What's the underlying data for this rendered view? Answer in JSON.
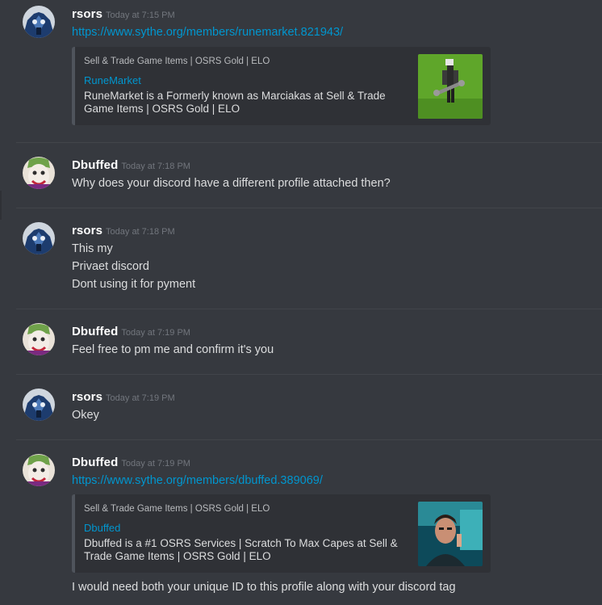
{
  "messages": [
    {
      "author": "rsors",
      "timestamp": "Today at 7:15 PM",
      "link": "https://www.sythe.org/members/runemarket.821943/",
      "embed": {
        "provider": "Sell & Trade Game Items | OSRS Gold | ELO",
        "title": "RuneMarket",
        "description": "RuneMarket is a Formerly known as Marciakas at Sell & Trade Game Items | OSRS Gold | ELO"
      }
    },
    {
      "author": "Dbuffed",
      "timestamp": "Today at 7:18 PM",
      "lines": [
        "Why does your discord have a different profile attached then?"
      ]
    },
    {
      "author": "rsors",
      "timestamp": "Today at 7:18 PM",
      "lines": [
        "This my",
        "Privaet discord",
        "Dont using it for pyment"
      ]
    },
    {
      "author": "Dbuffed",
      "timestamp": "Today at 7:19 PM",
      "lines": [
        "Feel free to pm me and confirm it's you"
      ]
    },
    {
      "author": "rsors",
      "timestamp": "Today at 7:19 PM",
      "lines": [
        "Okey"
      ]
    },
    {
      "author": "Dbuffed",
      "timestamp": "Today at 7:19 PM",
      "link": "https://www.sythe.org/members/dbuffed.389069/",
      "embed": {
        "provider": "Sell & Trade Game Items | OSRS Gold | ELO",
        "title": "Dbuffed",
        "description": "Dbuffed is a #1 OSRS Services | Scratch To Max Capes at Sell & Trade Game Items | OSRS Gold | ELO"
      },
      "lines": [
        "I would need both your unique ID to this profile along with your discord tag"
      ]
    }
  ]
}
